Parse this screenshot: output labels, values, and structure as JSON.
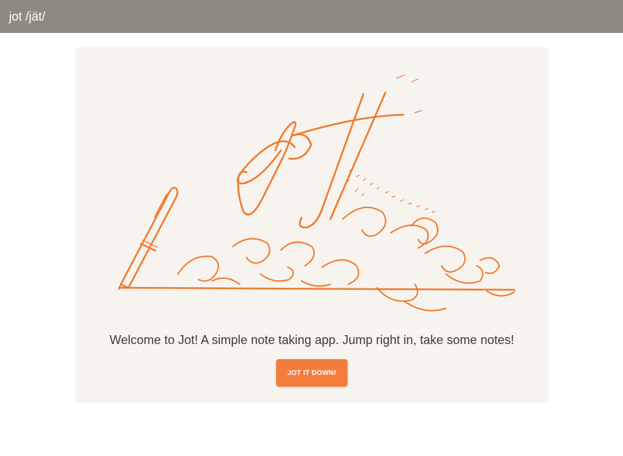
{
  "header": {
    "title": "jot /jät/"
  },
  "welcome": {
    "message": "Welcome to Jot! A simple note taking app. Jump right in, take some notes!",
    "button_label": "JOT IT DOWN!"
  },
  "illustration": {
    "icon": "jot-pen-signature-illustration",
    "wordmark": "Jot"
  },
  "colors": {
    "header_bg": "#8e8a82",
    "card_bg": "#f7f3ee",
    "accent": "#f47d3c",
    "text": "#3c3c3c"
  }
}
